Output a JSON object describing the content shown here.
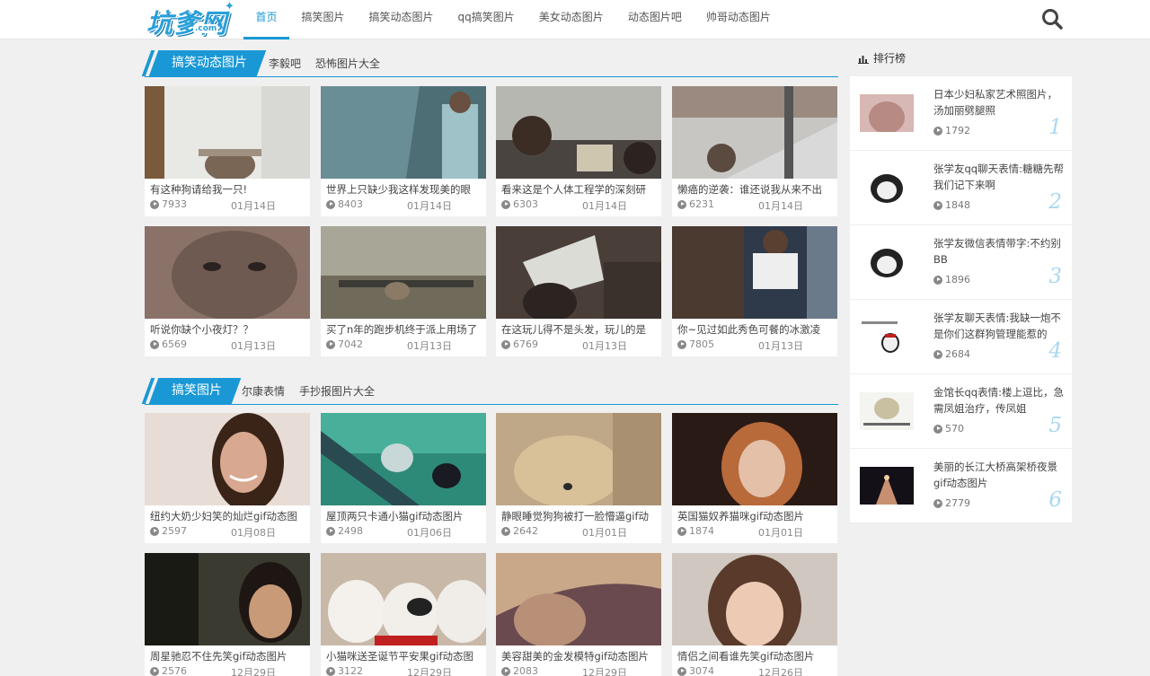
{
  "logo": {
    "text": "坑爹网",
    "sub": ".com"
  },
  "nav": [
    "首页",
    "搞笑图片",
    "搞笑动态图片",
    "qq搞笑图片",
    "美女动态图片",
    "动态图片吧",
    "帅哥动态图片"
  ],
  "sections": [
    {
      "title": "搞笑动态图片",
      "links": [
        "李毅吧",
        "恐怖图片大全"
      ],
      "cards": [
        {
          "title": "有这种狗请给我一只!",
          "views": "7933",
          "date": "01月14日"
        },
        {
          "title": "世界上只缺少我这样发现美的眼",
          "views": "8403",
          "date": "01月14日"
        },
        {
          "title": "看来这是个人体工程学的深刻研",
          "views": "6303",
          "date": "01月14日"
        },
        {
          "title": "懒癌的逆袭：谁还说我从来不出",
          "views": "6231",
          "date": "01月14日"
        },
        {
          "title": "听说你缺个小夜灯？？",
          "views": "6569",
          "date": "01月13日"
        },
        {
          "title": "买了n年的跑步机终于派上用场了",
          "views": "7042",
          "date": "01月13日"
        },
        {
          "title": "在这玩儿得不是头发，玩儿的是",
          "views": "6769",
          "date": "01月13日"
        },
        {
          "title": "你~见过如此秀色可餐的冰激凌",
          "views": "7805",
          "date": "01月13日"
        }
      ]
    },
    {
      "title": "搞笑图片",
      "links": [
        "尔康表情",
        "手抄报图片大全"
      ],
      "cards": [
        {
          "title": "纽约大奶少妇笑的灿烂gif动态图",
          "views": "2597",
          "date": "01月08日"
        },
        {
          "title": "屋顶两只卡通小猫gif动态图片",
          "views": "2498",
          "date": "01月06日"
        },
        {
          "title": "静眼睡觉狗狗被打一脸懵逼gif动",
          "views": "2642",
          "date": "01月01日"
        },
        {
          "title": "英国猫奴养猫咪gif动态图片",
          "views": "1874",
          "date": "01月01日"
        },
        {
          "title": "周星驰忍不住先笑gif动态图片",
          "views": "2576",
          "date": "12月29日"
        },
        {
          "title": "小猫咪送圣诞节平安果gif动态图",
          "views": "3122",
          "date": "12月29日"
        },
        {
          "title": "美容甜美的金发模特gif动态图片",
          "views": "2083",
          "date": "12月29日"
        },
        {
          "title": "情侣之间看谁先笑gif动态图片",
          "views": "3074",
          "date": "12月26日"
        }
      ]
    }
  ],
  "sidebar": {
    "title": "排行榜",
    "items": [
      {
        "text": "日本少妇私家艺术照图片，汤加丽劈腿照",
        "views": "1792",
        "num": "1"
      },
      {
        "text": "张学友qq聊天表情:糖糖先帮我们记下来啊",
        "views": "1848",
        "num": "2"
      },
      {
        "text": "张学友微信表情带字:不约别BB",
        "views": "1896",
        "num": "3"
      },
      {
        "text": "张学友聊天表情:我缺一炮不是你们这群狗管理能惹的",
        "views": "2684",
        "num": "4"
      },
      {
        "text": "金馆长qq表情:楼上逗比，急需凤姐治疗，传凤姐",
        "views": "570",
        "num": "5"
      },
      {
        "text": "美丽的长江大桥高架桥夜景gif动态图片",
        "views": "2779",
        "num": "6"
      }
    ]
  },
  "colors": {
    "accent": "#1a98d5",
    "rank_num": "#a9d8ef",
    "background": "#f0f0f0"
  },
  "icons": {
    "search": "search-icon",
    "view": "play-circle-icon",
    "rank": "bar-chart-icon"
  }
}
